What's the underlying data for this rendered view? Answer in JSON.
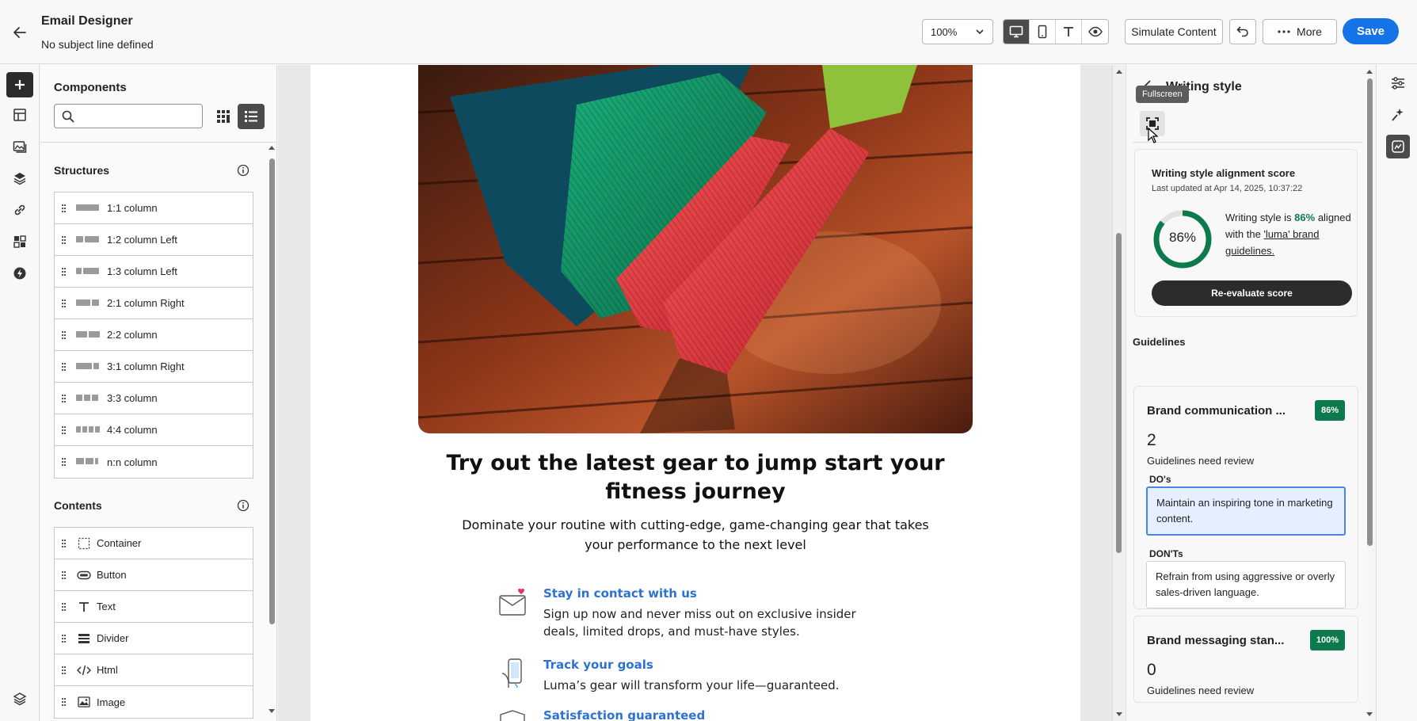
{
  "header": {
    "title": "Email Designer",
    "subtitle": "No subject line defined",
    "zoom": "100%",
    "simulate_label": "Simulate Content",
    "more_label": "More",
    "save_label": "Save"
  },
  "left_rail": {
    "icons": [
      "plus-icon",
      "template-icon",
      "image-assets-icon",
      "layers-icon",
      "link-icon",
      "fragments-icon",
      "flash-icon",
      "layers-bottom-icon"
    ]
  },
  "components": {
    "title": "Components",
    "search_placeholder": "",
    "structures": {
      "title": "Structures",
      "items": [
        {
          "label": "1:1 column",
          "cols": [
            1
          ]
        },
        {
          "label": "1:2 column Left",
          "cols": [
            1,
            2
          ]
        },
        {
          "label": "1:3 column Left",
          "cols": [
            1,
            3
          ]
        },
        {
          "label": "2:1 column Right",
          "cols": [
            2,
            1
          ]
        },
        {
          "label": "2:2 column",
          "cols": [
            1,
            1
          ]
        },
        {
          "label": "3:1 column Right",
          "cols": [
            3,
            1
          ]
        },
        {
          "label": "3:3 column",
          "cols": [
            1,
            1,
            1
          ]
        },
        {
          "label": "4:4 column",
          "cols": [
            1,
            1,
            1,
            1
          ]
        },
        {
          "label": "n:n column",
          "cols": [
            1,
            1,
            0.4
          ]
        }
      ]
    },
    "contents": {
      "title": "Contents",
      "items": [
        {
          "label": "Container",
          "icon": "container-icon"
        },
        {
          "label": "Button",
          "icon": "button-icon"
        },
        {
          "label": "Text",
          "icon": "text-icon"
        },
        {
          "label": "Divider",
          "icon": "divider-icon"
        },
        {
          "label": "Html",
          "icon": "code-icon"
        },
        {
          "label": "Image",
          "icon": "image-icon"
        }
      ]
    }
  },
  "email": {
    "headline": "Try out the latest gear to jump start your fitness journey",
    "subhead": "Dominate your routine with cutting-edge, game-changing gear that takes your performance to the next level",
    "features": [
      {
        "title": "Stay in contact with us",
        "body": "Sign up now and never miss out on exclusive insider deals, limited drops, and must-have styles.",
        "icon": "envelope-heart-icon"
      },
      {
        "title": "Track your goals",
        "body": "Luma’s gear will transform your life—guaranteed.",
        "icon": "phone-hand-icon"
      },
      {
        "title": "Satisfaction guaranteed",
        "body": "",
        "icon": "shield-icon"
      }
    ]
  },
  "writing_style": {
    "title": "Writing style",
    "tooltip": "Fullscreen",
    "score_card": {
      "title": "Writing style alignment score",
      "updated": "Last updated at Apr 14, 2025, 10:37:22",
      "score": 86,
      "score_label": "86%",
      "text_prefix": "Writing style is ",
      "text_pct": "86%",
      "text_mid": " aligned with the ",
      "text_link": "'luma' brand guidelines.",
      "button": "Re-evaluate score"
    },
    "guidelines_title": "Guidelines",
    "guidelines": [
      {
        "name": "Brand communication ...",
        "badge": "86%",
        "count": "2",
        "count_label": "Guidelines need review",
        "dos_title": "DO's",
        "dos": "Maintain an inspiring tone in marketing content.",
        "donts_title": "DON'Ts",
        "donts": "Refrain from using aggressive or overly sales-driven language."
      },
      {
        "name": "Brand messaging stan...",
        "badge": "100%",
        "count": "0",
        "count_label": "Guidelines need review"
      }
    ]
  },
  "colors": {
    "accent_blue": "#1473e6",
    "score_green": "#0d7a4e",
    "link_blue": "#2d72d2"
  }
}
